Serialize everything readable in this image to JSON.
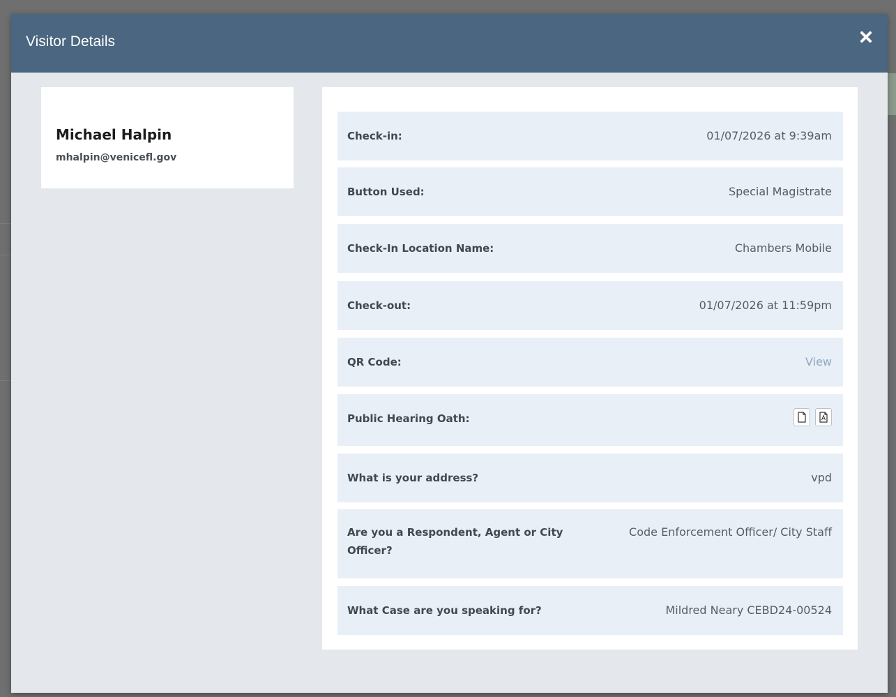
{
  "modal": {
    "title": "Visitor Details",
    "close_icon": "close-icon"
  },
  "profile": {
    "name": "Michael Halpin",
    "email": "mhalpin@venicefl.gov"
  },
  "details": {
    "check_in": {
      "label": "Check-in:",
      "value": "01/07/2026 at 9:39am"
    },
    "button_used": {
      "label": "Button Used:",
      "value": "Special Magistrate"
    },
    "location": {
      "label": "Check-In Location Name:",
      "value": "Chambers Mobile"
    },
    "check_out": {
      "label": "Check-out:",
      "value": "01/07/2026 at 11:59pm"
    },
    "qr_code": {
      "label": "QR Code:",
      "value": "View"
    },
    "oath": {
      "label": "Public Hearing Oath:",
      "icons": [
        "document-icon",
        "pdf-icon"
      ]
    },
    "address": {
      "label": "What is your address?",
      "value": "vpd"
    },
    "role": {
      "label": "Are you a Respondent, Agent or City Officer?",
      "value": "Code Enforcement Officer/ City Staff"
    },
    "case": {
      "label": "What Case are you speaking for?",
      "value": "Mildred Neary CEBD24-00524"
    }
  },
  "colors": {
    "header": "#4a6680",
    "row_background": "#e8eff7",
    "link": "#8fa6bf"
  }
}
